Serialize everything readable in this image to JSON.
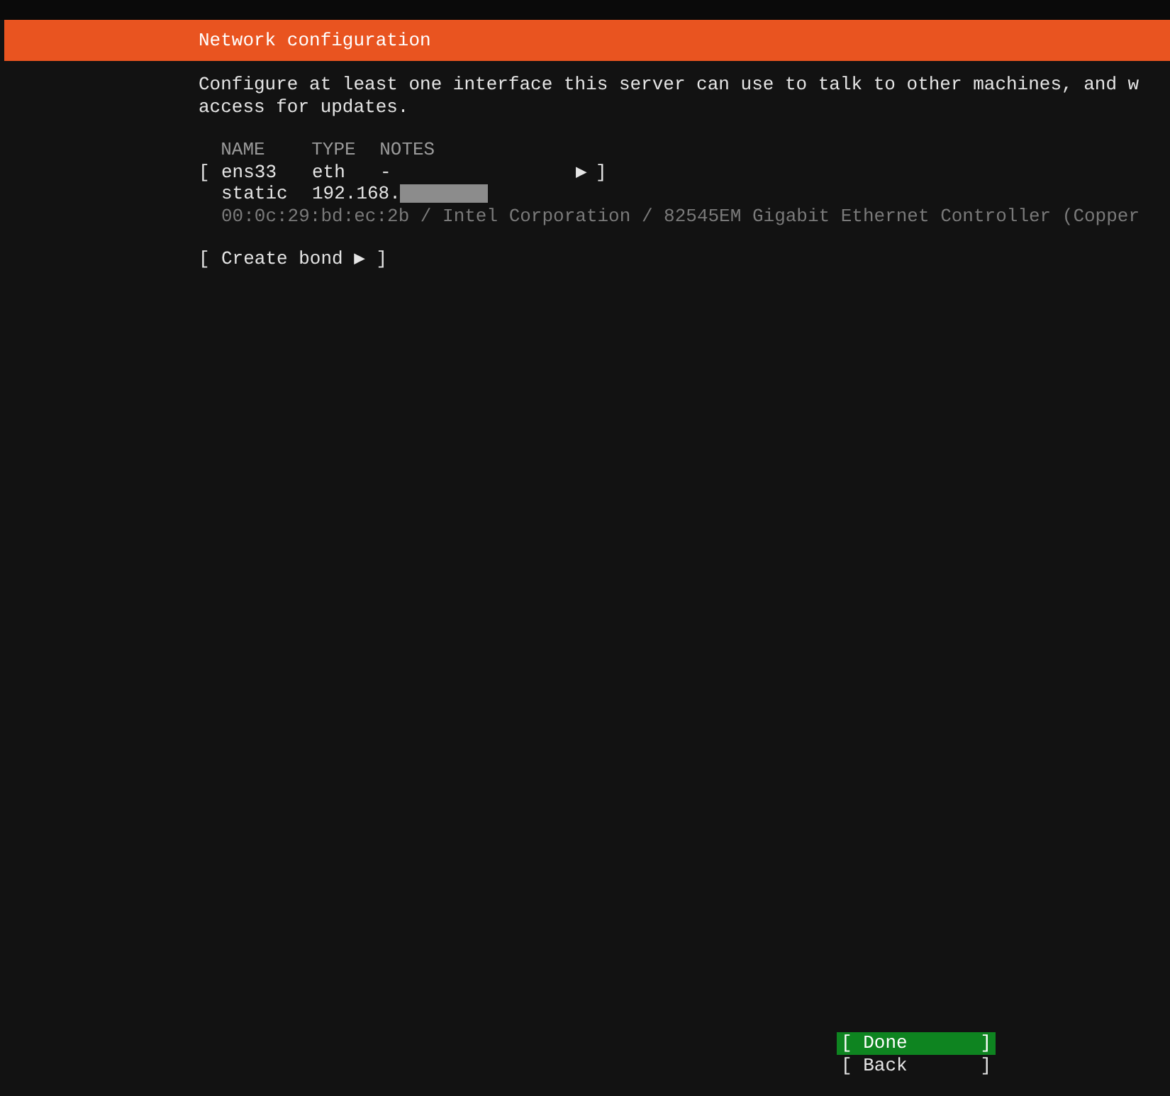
{
  "header": {
    "title": "Network configuration"
  },
  "intro": "Configure at least one interface this server can use to talk to other machines, and w",
  "access_line": "access for updates.",
  "table": {
    "columns": [
      "NAME",
      "TYPE",
      "NOTES"
    ],
    "interfaces": [
      {
        "open": "[",
        "name": "ens33",
        "type": "eth",
        "notes": "-",
        "arrow": "▶",
        "close": "]",
        "address_mode": "static",
        "address": "192.168.",
        "hardware": "00:0c:29:bd:ec:2b / Intel Corporation / 82545EM Gigabit Ethernet Controller (Copper"
      }
    ]
  },
  "create_bond": {
    "open": "[",
    "label": "Create bond",
    "arrow": "▶",
    "close": "]"
  },
  "buttons": [
    {
      "open": "[",
      "label": "Done",
      "close": "]",
      "selected": true
    },
    {
      "open": "[",
      "label": "Back",
      "close": "]",
      "selected": false
    }
  ]
}
